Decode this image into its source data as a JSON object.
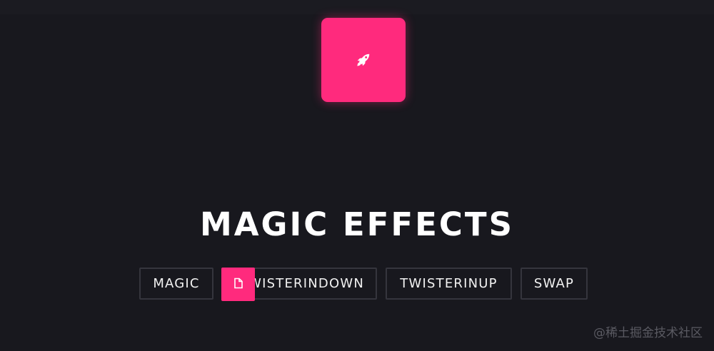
{
  "hero": {
    "icon": "rocket-icon"
  },
  "title": "MAGIC EFFECTS",
  "buttons": {
    "magic": "MAGIC",
    "twisterindown": "TWISTERINDOWN",
    "twisterinup": "TWISTERINUP",
    "swap": "SWAP"
  },
  "overlay": {
    "icon": "file-icon"
  },
  "watermark": "@稀土掘金技术社区",
  "colors": {
    "background": "#18181e",
    "accent": "#ff2a7d",
    "text": "#ffffff",
    "button_border": "#35353d"
  }
}
